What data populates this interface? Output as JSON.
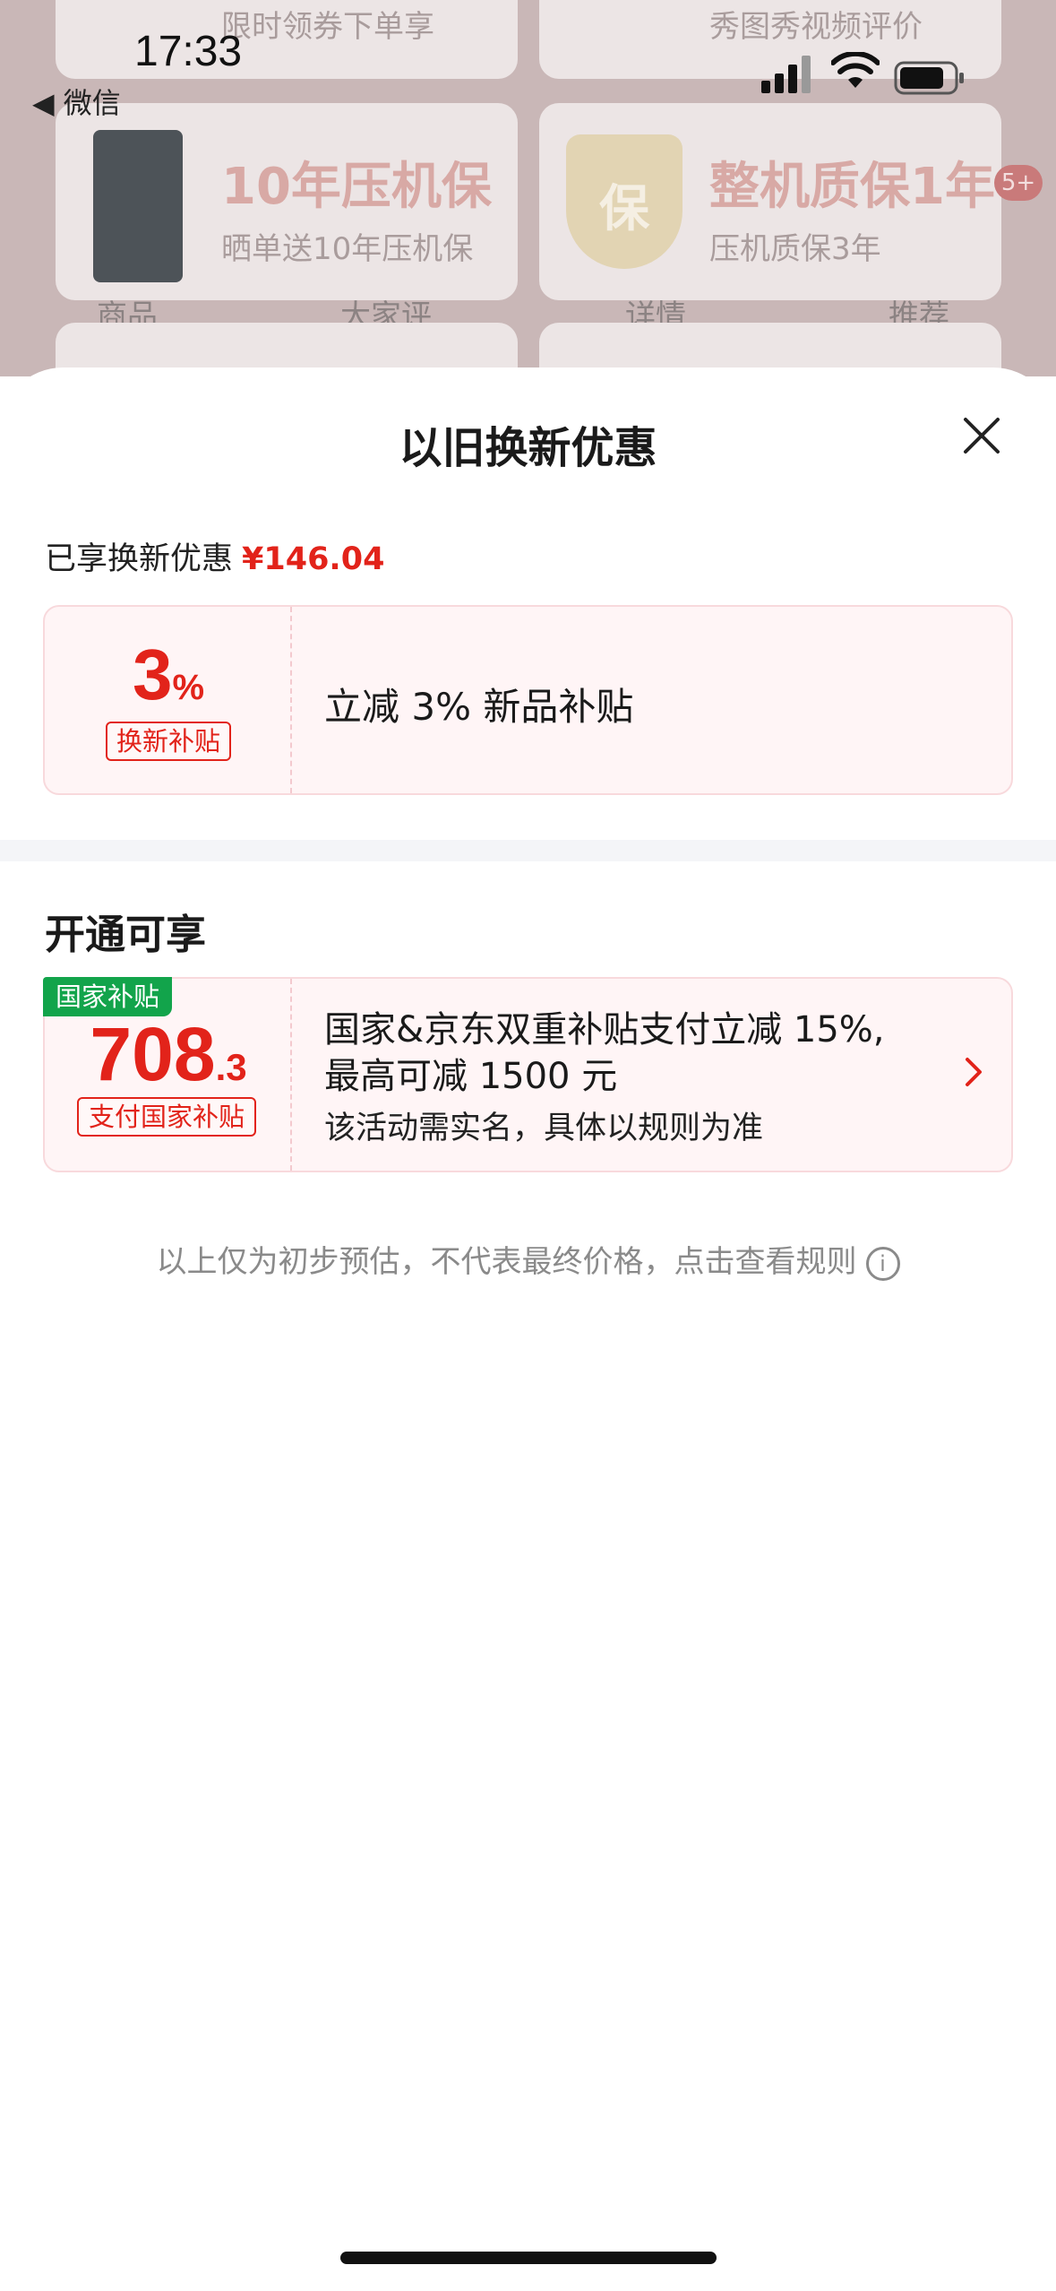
{
  "status_bar": {
    "time": "17:33",
    "back_app": "◀ 微信"
  },
  "background": {
    "card_top_left_text": "限时领券下单享",
    "card_top_right_text": "秀图秀视频评价",
    "card_left_title": "10年压机保",
    "card_left_sub": "晒单送10年压机保",
    "card_right_title": "整机质保1年",
    "card_right_sub": "压机质保3年",
    "shield_char": "保",
    "badge": "5+",
    "tabs": [
      "商品",
      "大家评",
      "详情",
      "推荐"
    ]
  },
  "sheet": {
    "title": "以旧换新优惠",
    "enjoyed_label": "已享换新优惠",
    "enjoyed_amount": "¥146.04",
    "trade_in_card": {
      "value": "3",
      "unit": "%",
      "tag": "换新补贴",
      "description": "立减 3% 新品补贴"
    },
    "section_title": "开通可享",
    "subsidy_card": {
      "corner_tag": "国家补贴",
      "value_int": "708",
      "value_dec": ".3",
      "tag": "支付国家补贴",
      "line1": "国家&京东双重补贴支付立减 15%,",
      "line2": "最高可减 1500 元",
      "line3": "该活动需实名，具体以规则为准"
    },
    "disclaimer": "以上仅为初步预估，不代表最终价格，点击查看规则",
    "info_icon_glyph": "i"
  },
  "colors": {
    "accent_red": "#e2231a",
    "green": "#12a44b",
    "card_bg": "#fff5f6"
  }
}
